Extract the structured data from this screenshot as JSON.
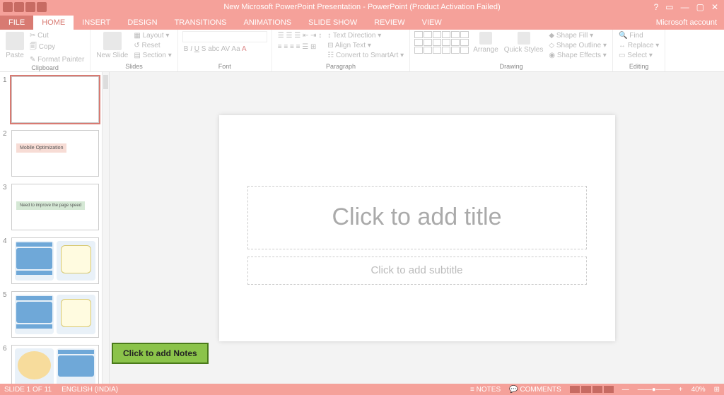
{
  "title": "New Microsoft PowerPoint Presentation - PowerPoint (Product Activation Failed)",
  "account": "Microsoft account",
  "tabs": {
    "file": "FILE",
    "home": "HOME",
    "insert": "INSERT",
    "design": "DESIGN",
    "transitions": "TRANSITIONS",
    "animations": "ANIMATIONS",
    "slideshow": "SLIDE SHOW",
    "review": "REVIEW",
    "view": "VIEW"
  },
  "ribbon": {
    "clipboard": {
      "label": "Clipboard",
      "paste": "Paste",
      "cut": "Cut",
      "copy": "Copy",
      "fp": "Format Painter"
    },
    "slides": {
      "label": "Slides",
      "new": "New\nSlide",
      "layout": "Layout",
      "reset": "Reset",
      "section": "Section"
    },
    "font": {
      "label": "Font"
    },
    "paragraph": {
      "label": "Paragraph",
      "textdir": "Text Direction",
      "align": "Align Text",
      "smartart": "Convert to SmartArt"
    },
    "drawing": {
      "label": "Drawing",
      "arrange": "Arrange",
      "quick": "Quick\nStyles",
      "fill": "Shape Fill",
      "outline": "Shape Outline",
      "effects": "Shape Effects"
    },
    "editing": {
      "label": "Editing",
      "find": "Find",
      "replace": "Replace",
      "select": "Select"
    }
  },
  "thumbs": {
    "t2": "Mobile Optimization",
    "t3": "Need to improve the page speed"
  },
  "slide": {
    "title_ph": "Click to add title",
    "subtitle_ph": "Click to add subtitle"
  },
  "notes_callout": "Click to add Notes",
  "status": {
    "slide": "SLIDE 1 OF 11",
    "lang": "ENGLISH (INDIA)",
    "notes": "NOTES",
    "comments": "COMMENTS",
    "zoom": "40%"
  }
}
